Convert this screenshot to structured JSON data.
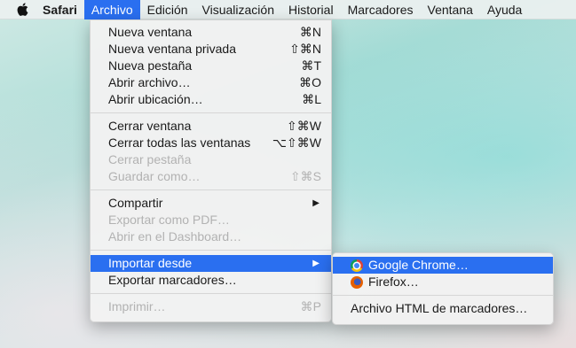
{
  "menubar": {
    "app": "Safari",
    "items": [
      "Archivo",
      "Edición",
      "Visualización",
      "Historial",
      "Marcadores",
      "Ventana",
      "Ayuda"
    ]
  },
  "file_menu": {
    "items": [
      {
        "label": "Nueva ventana",
        "shortcut": "⌘N"
      },
      {
        "label": "Nueva ventana privada",
        "shortcut": "⇧⌘N"
      },
      {
        "label": "Nueva pestaña",
        "shortcut": "⌘T"
      },
      {
        "label": "Abrir archivo…",
        "shortcut": "⌘O"
      },
      {
        "label": "Abrir ubicación…",
        "shortcut": "⌘L"
      },
      {
        "label": "Cerrar ventana",
        "shortcut": "⇧⌘W"
      },
      {
        "label": "Cerrar todas las ventanas",
        "shortcut": "⌥⇧⌘W"
      },
      {
        "label": "Cerrar pestaña",
        "shortcut": ""
      },
      {
        "label": "Guardar como…",
        "shortcut": "⇧⌘S"
      },
      {
        "label": "Compartir",
        "shortcut": ""
      },
      {
        "label": "Exportar como PDF…",
        "shortcut": ""
      },
      {
        "label": "Abrir en el Dashboard…",
        "shortcut": ""
      },
      {
        "label": "Importar desde",
        "shortcut": ""
      },
      {
        "label": "Exportar marcadores…",
        "shortcut": ""
      },
      {
        "label": "Imprimir…",
        "shortcut": "⌘P"
      }
    ]
  },
  "import_submenu": {
    "items": [
      {
        "label": "Google Chrome…"
      },
      {
        "label": "Firefox…"
      },
      {
        "label": "Archivo HTML de marcadores…"
      }
    ]
  },
  "icons": {
    "apple": "apple-icon",
    "submenu_arrow": "▶"
  },
  "colors": {
    "highlight": "#2a6ff0",
    "disabled_text": "#b2b2b2"
  }
}
